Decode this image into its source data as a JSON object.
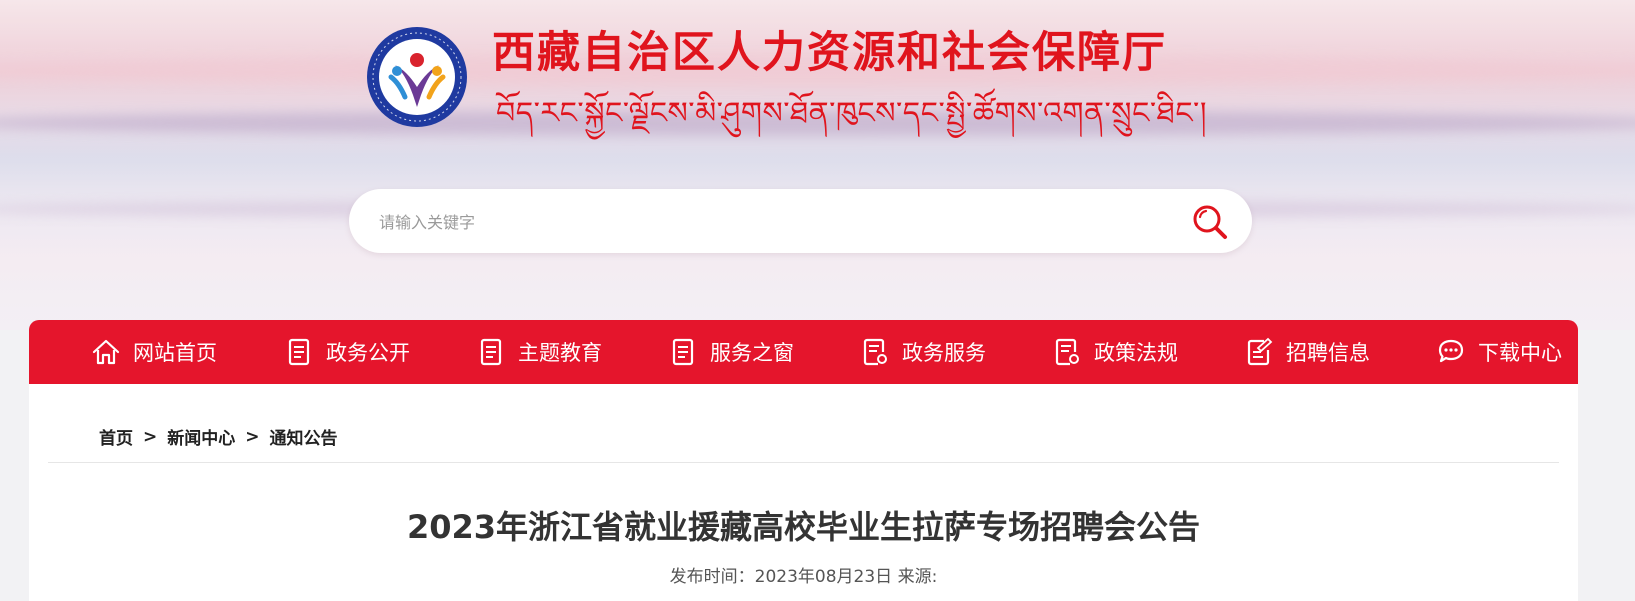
{
  "header": {
    "title": "西藏自治区人力资源和社会保障厅",
    "subtitle_tibetan": "བོད་རང་སྐྱོང་ལྗོངས་མི་ཤུགས་ཐོན་ཁུངས་དང་སྤྱི་ཚོགས་འགན་སྲུང་ཐིང་།"
  },
  "search": {
    "placeholder": "请输入关键字",
    "value": ""
  },
  "nav": {
    "items": [
      {
        "label": "网站首页",
        "icon": "home-icon"
      },
      {
        "label": "政务公开",
        "icon": "document-icon"
      },
      {
        "label": "主题教育",
        "icon": "document-icon"
      },
      {
        "label": "服务之窗",
        "icon": "document-icon"
      },
      {
        "label": "政务服务",
        "icon": "document-settings-icon"
      },
      {
        "label": "政策法规",
        "icon": "document-settings-icon"
      },
      {
        "label": "招聘信息",
        "icon": "edit-document-icon"
      },
      {
        "label": "下载中心",
        "icon": "chat-icon"
      }
    ]
  },
  "breadcrumb": {
    "items": [
      "首页",
      "新闻中心",
      "通知公告"
    ],
    "separator": ">"
  },
  "article": {
    "title": "2023年浙江省就业援藏高校毕业生拉萨专场招聘会公告",
    "meta": "发布时间：2023年08月23日  来源:"
  },
  "colors": {
    "brand_red": "#e5152c",
    "title_red": "#e0141d",
    "logo_blue": "#1f3aa0"
  }
}
